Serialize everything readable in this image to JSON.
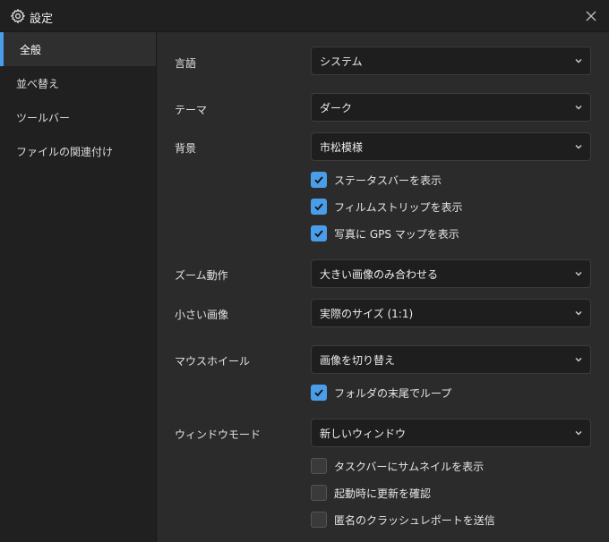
{
  "window": {
    "title": "設定",
    "accent": "#4a9de8"
  },
  "sidebar": {
    "items": [
      {
        "label": "全般",
        "active": true
      },
      {
        "label": "並べ替え",
        "active": false
      },
      {
        "label": "ツールバー",
        "active": false
      },
      {
        "label": "ファイルの関連付け",
        "active": false
      }
    ]
  },
  "settings": {
    "language": {
      "label": "言語",
      "value": "システム"
    },
    "theme": {
      "label": "テーマ",
      "value": "ダーク"
    },
    "background": {
      "label": "背景",
      "value": "市松模様"
    },
    "show_statusbar": {
      "label": "ステータスバーを表示",
      "checked": true
    },
    "show_filmstrip": {
      "label": "フィルムストリップを表示",
      "checked": true
    },
    "show_gps_map": {
      "label": "写真に GPS マップを表示",
      "checked": true
    },
    "zoom_behavior": {
      "label": "ズーム動作",
      "value": "大きい画像のみ合わせる"
    },
    "small_image": {
      "label": "小さい画像",
      "value": "実際のサイズ (1:1)"
    },
    "mouse_wheel": {
      "label": "マウスホイール",
      "value": "画像を切り替え"
    },
    "loop_folder": {
      "label": "フォルダの末尾でループ",
      "checked": true
    },
    "window_mode": {
      "label": "ウィンドウモード",
      "value": "新しいウィンドウ"
    },
    "taskbar_thumbnail": {
      "label": "タスクバーにサムネイルを表示",
      "checked": false
    },
    "check_updates": {
      "label": "起動時に更新を確認",
      "checked": false
    },
    "crash_reports": {
      "label": "匿名のクラッシュレポートを送信",
      "checked": false
    }
  }
}
